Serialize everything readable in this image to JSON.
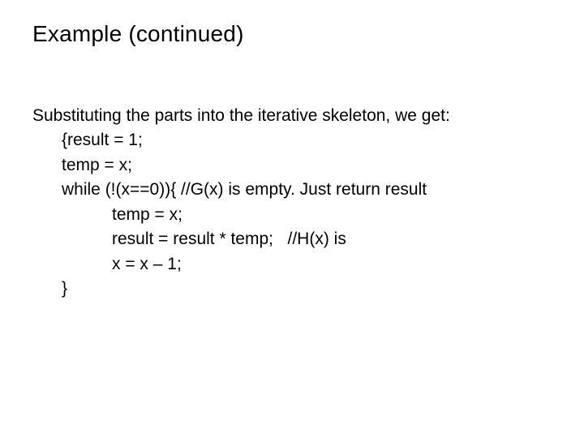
{
  "title": "Example (continued)",
  "body": {
    "intro": "Substituting the parts into the iterative skeleton, we get:",
    "l1": "{result = 1;",
    "l2": "temp = x;",
    "l3": "while (!(x==0)){ //G(x) is empty. Just return result",
    "l4": "temp = x;",
    "l5": "result = result * temp;   //H(x) is",
    "l6": "x = x – 1;",
    "l7": "}"
  }
}
